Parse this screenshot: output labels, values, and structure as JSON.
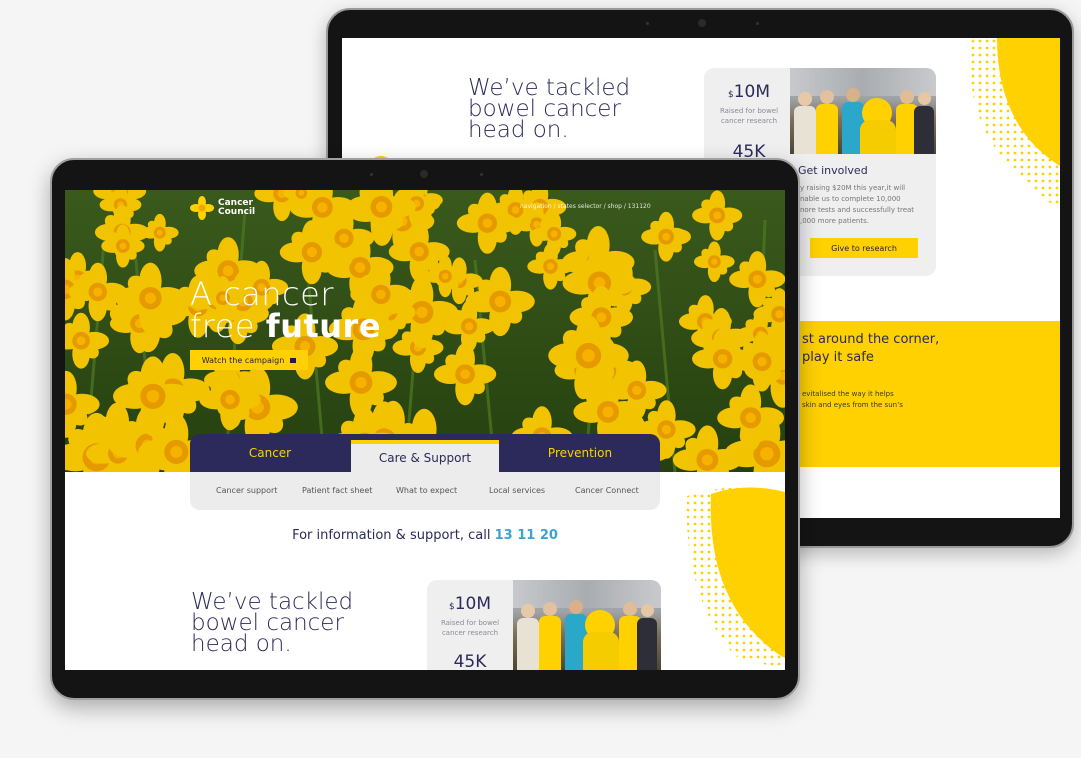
{
  "back_screen": {
    "heading_lines": [
      "We’ve tackled",
      "bowel cancer",
      "head on."
    ],
    "stat_amount": "10M",
    "stat_currency": "$",
    "stat_caption_lines": [
      "Raised for bowel",
      "cancer research"
    ],
    "stat_next": "45K",
    "get_involved_title": "Get involved",
    "get_involved_text_lines": [
      "y raising $20M this year,it will",
      "nable us to complete 10,000",
      "nore tests and successfully treat",
      ",000 more patients."
    ],
    "give_button": "Give to research",
    "banner_title_lines": [
      "st around the corner,",
      " play it safe"
    ],
    "banner_text_lines": [
      "evitalised the way it helps",
      "skin and eyes from the sun’s"
    ]
  },
  "front_screen": {
    "logo_line1": "Cancer",
    "logo_line2": "Council",
    "top_nav": "navigation / states selector / shop / 131120",
    "hero_line1": "A cancer",
    "hero_line2_light": "free ",
    "hero_line2_bold": "future",
    "hero_button": "Watch the campaign",
    "tabs": [
      "Cancer",
      "Care & Support",
      "Prevention"
    ],
    "subnav": [
      "Cancer support",
      "Patient fact sheet",
      "What to expect",
      "Local services",
      "Cancer Connect"
    ],
    "support_text": "For information & support, call ",
    "support_number": "13 11 20",
    "heading_lines": [
      "We’ve tackled",
      "bowel cancer",
      "head on."
    ],
    "stat_currency": "$",
    "stat_amount": "10M",
    "stat_caption_lines": [
      "Raised for bowel",
      "cancer research"
    ],
    "stat_next": "45K"
  },
  "colors": {
    "brand_yellow": "#ffd100",
    "navy": "#2b2a5a",
    "accent_blue": "#3aa3d8"
  }
}
